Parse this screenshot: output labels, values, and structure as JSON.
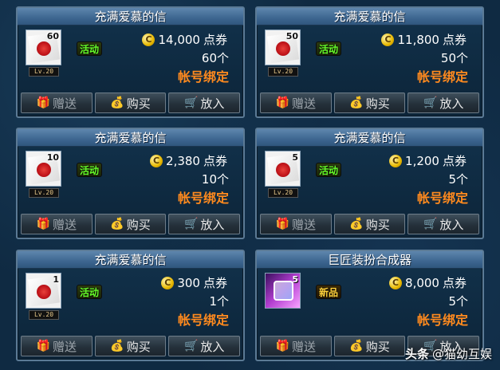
{
  "items": [
    {
      "title": "充满爱慕的信",
      "count": "60",
      "level": "Lv.20",
      "tag": "活动",
      "tag_color": "#66ff2a",
      "price": "14,000",
      "currency": "点券",
      "qty": "60个",
      "bind": "帐号绑定",
      "gift": "赠送",
      "buy": "购买",
      "put": "放入",
      "icon": "love-letter-icon"
    },
    {
      "title": "充满爱慕的信",
      "count": "50",
      "level": "Lv.20",
      "tag": "活动",
      "tag_color": "#66ff2a",
      "price": "11,800",
      "currency": "点券",
      "qty": "50个",
      "bind": "帐号绑定",
      "gift": "赠送",
      "buy": "购买",
      "put": "放入",
      "icon": "love-letter-icon"
    },
    {
      "title": "充满爱慕的信",
      "count": "10",
      "level": "Lv.20",
      "tag": "活动",
      "tag_color": "#66ff2a",
      "price": "2,380",
      "currency": "点券",
      "qty": "10个",
      "bind": "帐号绑定",
      "gift": "赠送",
      "buy": "购买",
      "put": "放入",
      "icon": "love-letter-icon"
    },
    {
      "title": "充满爱慕的信",
      "count": "5",
      "level": "Lv.20",
      "tag": "活动",
      "tag_color": "#66ff2a",
      "price": "1,200",
      "currency": "点券",
      "qty": "5个",
      "bind": "帐号绑定",
      "gift": "赠送",
      "buy": "购买",
      "put": "放入",
      "icon": "love-letter-icon"
    },
    {
      "title": "充满爱慕的信",
      "count": "1",
      "level": "Lv.20",
      "tag": "活动",
      "tag_color": "#66ff2a",
      "price": "300",
      "currency": "点券",
      "qty": "1个",
      "bind": "帐号绑定",
      "gift": "赠送",
      "buy": "购买",
      "put": "放入",
      "icon": "love-letter-icon"
    },
    {
      "title": "巨匠装扮合成器",
      "count": "5",
      "level": "",
      "tag": "新品",
      "tag_color": "#ffd23b",
      "price": "8,000",
      "currency": "点券",
      "qty": "5个",
      "bind": "帐号绑定",
      "gift": "赠送",
      "buy": "购买",
      "put": "放入",
      "icon": "synthesizer-icon"
    }
  ],
  "watermark": {
    "brand": "头条",
    "handle": "@猫幼互娱"
  },
  "colors": {
    "accent_orange": "#ff8a1e",
    "header_blue": "#3d6690",
    "tag_green": "#66ff2a",
    "tag_gold": "#ffd23b"
  }
}
